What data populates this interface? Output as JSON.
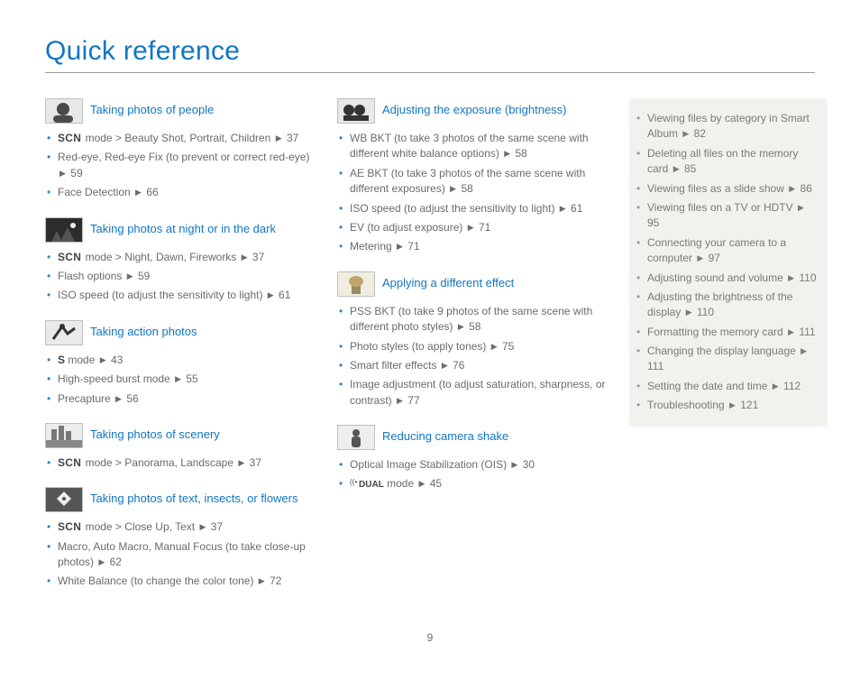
{
  "title": "Quick reference",
  "pageNumber": "9",
  "sections_left": [
    {
      "title": "Taking photos of people",
      "icon": "face",
      "items": [
        {
          "prefix": "SCN",
          "text": " mode > Beauty Shot, Portrait, Children ",
          "page": "37"
        },
        {
          "text": "Red-eye, Red-eye Fix (to prevent or correct red-eye) ",
          "page": "59"
        },
        {
          "text": "Face Detection ",
          "page": "66"
        }
      ]
    },
    {
      "title": "Taking photos at night or in the dark",
      "icon": "night",
      "items": [
        {
          "prefix": "SCN",
          "text": " mode > Night, Dawn, Fireworks ",
          "page": "37"
        },
        {
          "text": "Flash options ",
          "page": "59"
        },
        {
          "text": "ISO speed (to adjust the sensitivity to light) ",
          "page": "61"
        }
      ]
    },
    {
      "title": "Taking action photos",
      "icon": "action",
      "items": [
        {
          "prefix": "S",
          "text": " mode ",
          "page": "43"
        },
        {
          "text": "High-speed burst mode ",
          "page": "55"
        },
        {
          "text": "Precapture ",
          "page": "56"
        }
      ]
    },
    {
      "title": "Taking photos of scenery",
      "icon": "scenery",
      "items": [
        {
          "prefix": "SCN",
          "text": " mode > Panorama, Landscape ",
          "page": "37"
        }
      ]
    },
    {
      "title": "Taking photos of text, insects, or flowers",
      "icon": "macro",
      "items": [
        {
          "prefix": "SCN",
          "text": " mode > Close Up, Text ",
          "page": "37"
        },
        {
          "text": "Macro, Auto Macro, Manual Focus (to take close-up photos) ",
          "page": "62"
        },
        {
          "text": "White Balance (to change the color tone) ",
          "page": "72"
        }
      ]
    }
  ],
  "sections_mid": [
    {
      "title": "Adjusting the exposure (brightness)",
      "icon": "exposure",
      "items": [
        {
          "text": "WB BKT (to take 3 photos of the same scene with different white balance options) ",
          "page": "58"
        },
        {
          "text": "AE BKT (to take 3 photos of the same scene with different exposures) ",
          "page": "58"
        },
        {
          "text": "ISO speed (to adjust the sensitivity to light) ",
          "page": "61"
        },
        {
          "text": "EV (to adjust exposure) ",
          "page": "71"
        },
        {
          "text": "Metering ",
          "page": "71"
        }
      ]
    },
    {
      "title": "Applying a different effect",
      "icon": "effect",
      "items": [
        {
          "text": "PSS BKT (to take 9 photos of the same scene with different photo styles) ",
          "page": "58"
        },
        {
          "text": "Photo styles (to apply tones) ",
          "page": "75"
        },
        {
          "text": "Smart filter effects ",
          "page": "76"
        },
        {
          "text": "Image adjustment (to adjust saturation, sharpness, or contrast) ",
          "page": "77"
        }
      ]
    },
    {
      "title": "Reducing camera shake",
      "icon": "shake",
      "items": [
        {
          "text": "Optical Image Stabilization (OIS) ",
          "page": "30"
        },
        {
          "prefix": "DUAL",
          "text": " mode ",
          "page": "45"
        }
      ]
    }
  ],
  "sidebar": [
    {
      "text": "Viewing files by category in Smart Album ",
      "page": "82"
    },
    {
      "text": "Deleting all files on the memory card ",
      "page": "85"
    },
    {
      "text": "Viewing files as a slide show ",
      "page": "86"
    },
    {
      "text": "Viewing files on a TV or HDTV ",
      "page": "95"
    },
    {
      "text": "Connecting your camera to a computer ",
      "page": "97"
    },
    {
      "text": "Adjusting sound and volume ",
      "page": "110"
    },
    {
      "text": "Adjusting the brightness of the display ",
      "page": "110"
    },
    {
      "text": "Formatting the memory card ",
      "page": "111"
    },
    {
      "text": "Changing the display language ",
      "page": "111"
    },
    {
      "text": "Setting the date and time ",
      "page": "112"
    },
    {
      "text": "Troubleshooting ",
      "page": "121"
    }
  ]
}
